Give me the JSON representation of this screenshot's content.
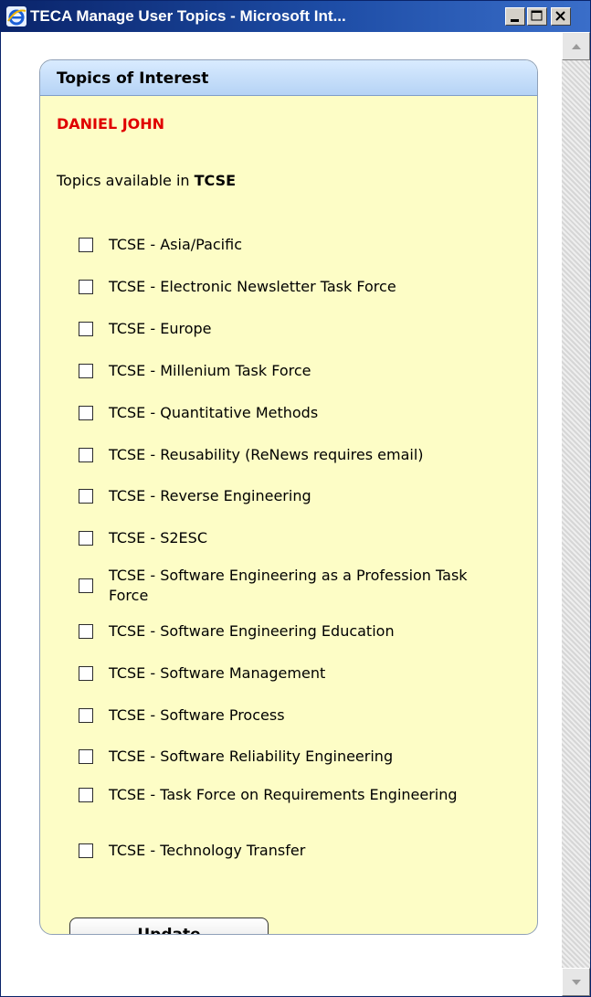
{
  "window": {
    "title": "TECA Manage User Topics - Microsoft Int..."
  },
  "panel": {
    "title": "Topics of Interest",
    "user_name": "DANIEL JOHN",
    "available_prefix": "Topics available in ",
    "available_group": "TCSE"
  },
  "topics": [
    {
      "label": "TCSE - Asia/Pacific",
      "checked": false
    },
    {
      "label": "TCSE - Electronic Newsletter Task Force",
      "checked": false
    },
    {
      "label": "TCSE - Europe",
      "checked": false
    },
    {
      "label": "TCSE - Millenium Task Force",
      "checked": false
    },
    {
      "label": "TCSE - Quantitative Methods",
      "checked": false
    },
    {
      "label": "TCSE - Reusability (ReNews requires email)",
      "checked": false
    },
    {
      "label": "TCSE - Reverse Engineering",
      "checked": false
    },
    {
      "label": "TCSE - S2ESC",
      "checked": false
    },
    {
      "label": "TCSE - Software Engineering as a Profession Task Force",
      "checked": false
    },
    {
      "label": "TCSE - Software Engineering Education",
      "checked": false
    },
    {
      "label": "TCSE - Software Management",
      "checked": false
    },
    {
      "label": "TCSE - Software Process",
      "checked": false
    },
    {
      "label": "TCSE - Software Reliability Engineering",
      "checked": false
    },
    {
      "label": "TCSE - Task Force on Requirements Engineering",
      "checked": false
    },
    {
      "label": "TCSE - Technology Transfer",
      "checked": false
    }
  ],
  "buttons": {
    "update": "Update"
  },
  "colors": {
    "title_bar": "#0a246a",
    "panel_bg": "#fdfdc6",
    "panel_header": "#b5d3f5",
    "user_name": "#e00000"
  }
}
